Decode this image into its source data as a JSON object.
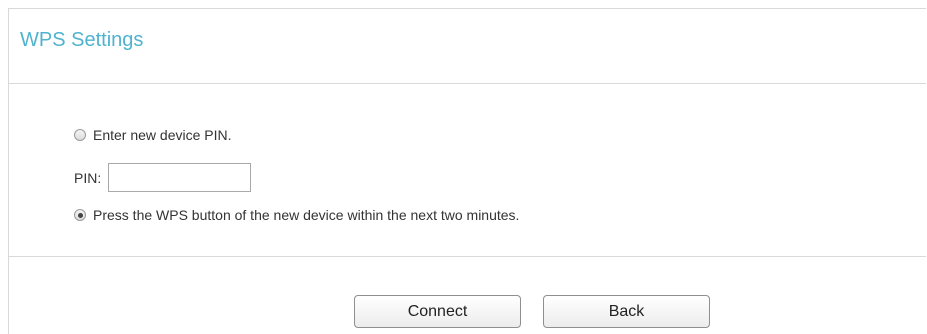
{
  "header": {
    "title": "WPS Settings"
  },
  "options": {
    "pin_option": {
      "label": "Enter new device PIN.",
      "selected": false
    },
    "pin_field": {
      "label": "PIN:",
      "value": "",
      "placeholder": ""
    },
    "push_option": {
      "label": "Press the WPS button of the new device within the next two minutes.",
      "selected": true
    }
  },
  "actions": {
    "connect_label": "Connect",
    "back_label": "Back"
  },
  "colors": {
    "title": "#4fb3cf",
    "border": "#d9d9d9"
  }
}
